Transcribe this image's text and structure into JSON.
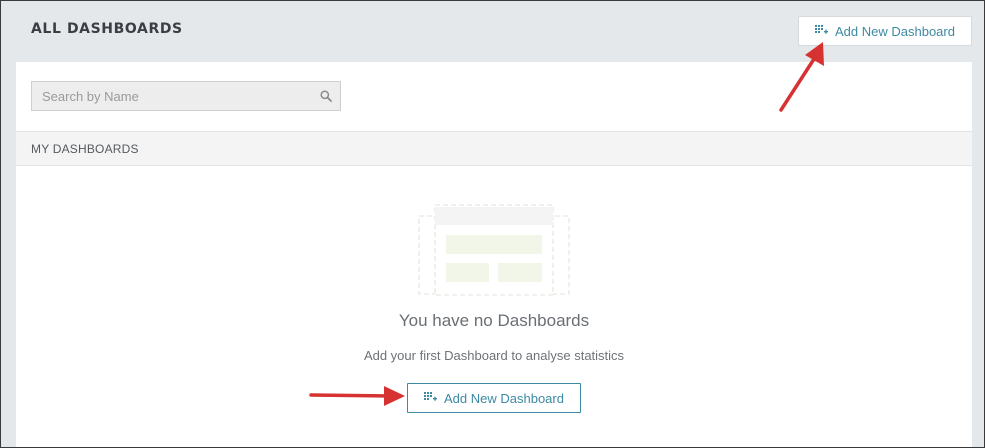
{
  "header": {
    "title": "ALL DASHBOARDS",
    "add_button_label": "Add New Dashboard",
    "add_button_icon": "dashboard-add-icon"
  },
  "search": {
    "placeholder": "Search by Name",
    "value": "",
    "icon": "search-icon"
  },
  "section": {
    "title": "MY DASHBOARDS"
  },
  "empty_state": {
    "illustration": "dashboard-placeholder-illustration",
    "title": "You have no Dashboards",
    "subtitle": "Add your first Dashboard to analyse statistics",
    "button_label": "Add New Dashboard",
    "button_icon": "dashboard-add-icon"
  },
  "colors": {
    "accent": "#3d8aa3",
    "header_bg": "#e5e8eb",
    "annotation_arrow": "#d63232",
    "placeholder_green": "#f1f6e9"
  }
}
